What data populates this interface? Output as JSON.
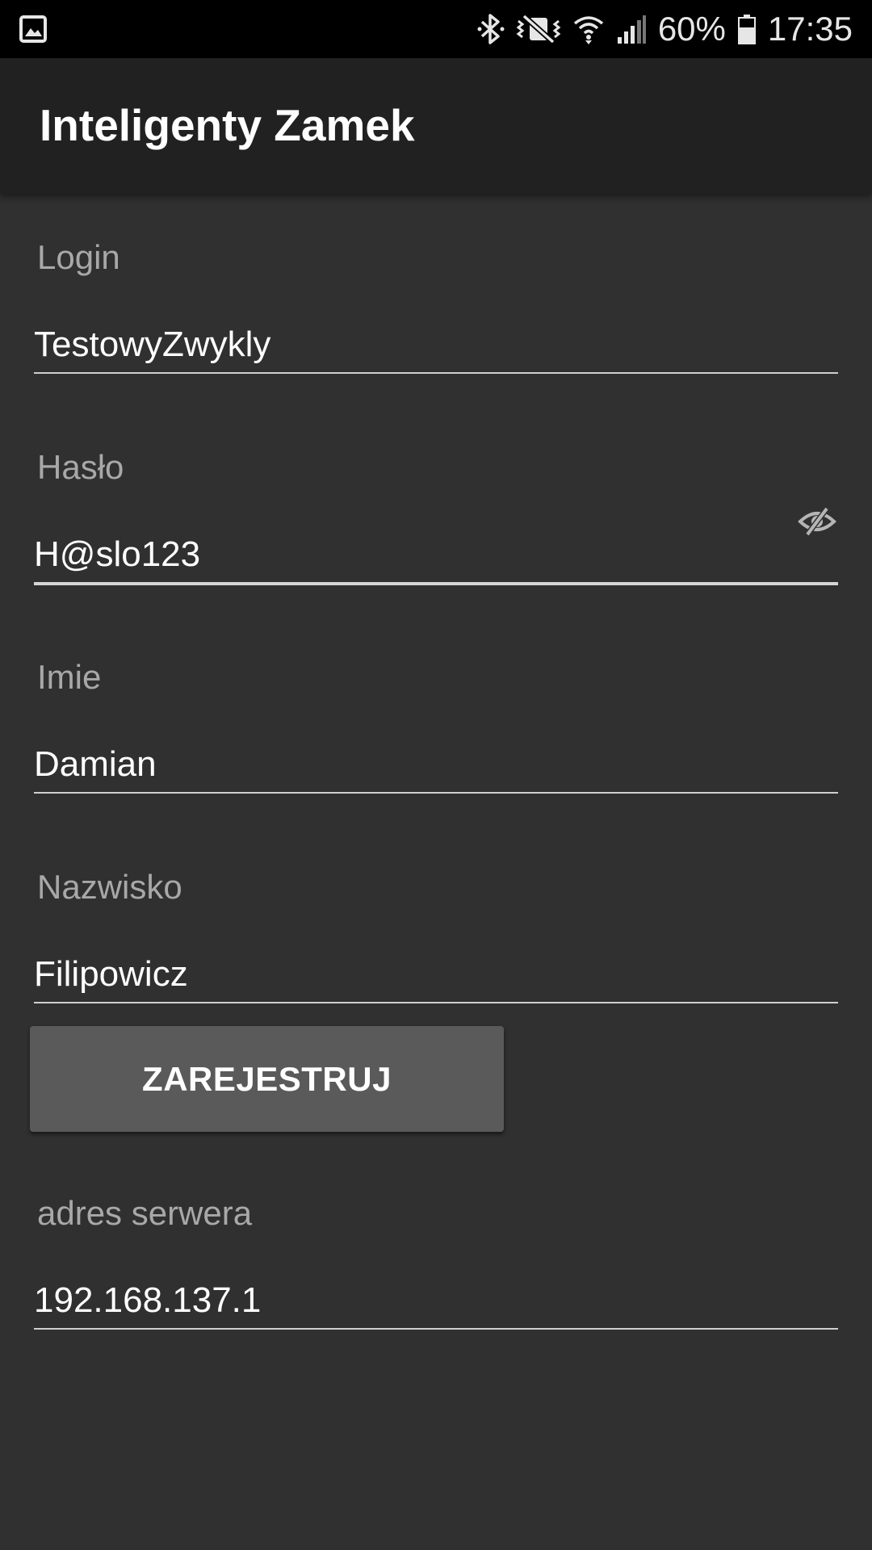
{
  "status_bar": {
    "left_icon": "gallery-icon",
    "icons": [
      "bluetooth-icon",
      "vibrate-mute-icon",
      "wifi-icon",
      "signal-icon",
      "battery-icon"
    ],
    "battery": "60%",
    "time": "17:35"
  },
  "app_bar": {
    "title": "Inteligenty Zamek"
  },
  "form": {
    "login": {
      "label": "Login",
      "value": "TestowyZwykly"
    },
    "password": {
      "label": "Hasło",
      "value": "H@slo123",
      "toggle_icon": "eye-off-icon"
    },
    "first_name": {
      "label": "Imie",
      "value": "Damian"
    },
    "last_name": {
      "label": "Nazwisko",
      "value": "Filipowicz"
    },
    "register_button": "ZAREJESTRUJ",
    "server": {
      "label": "adres serwera",
      "value": "192.168.137.1"
    }
  },
  "colors": {
    "background": "#303030",
    "app_bar": "#212121",
    "status_bar": "#000000",
    "button": "#5a5a5b",
    "label": "#a8a8a8",
    "text": "#ffffff"
  }
}
